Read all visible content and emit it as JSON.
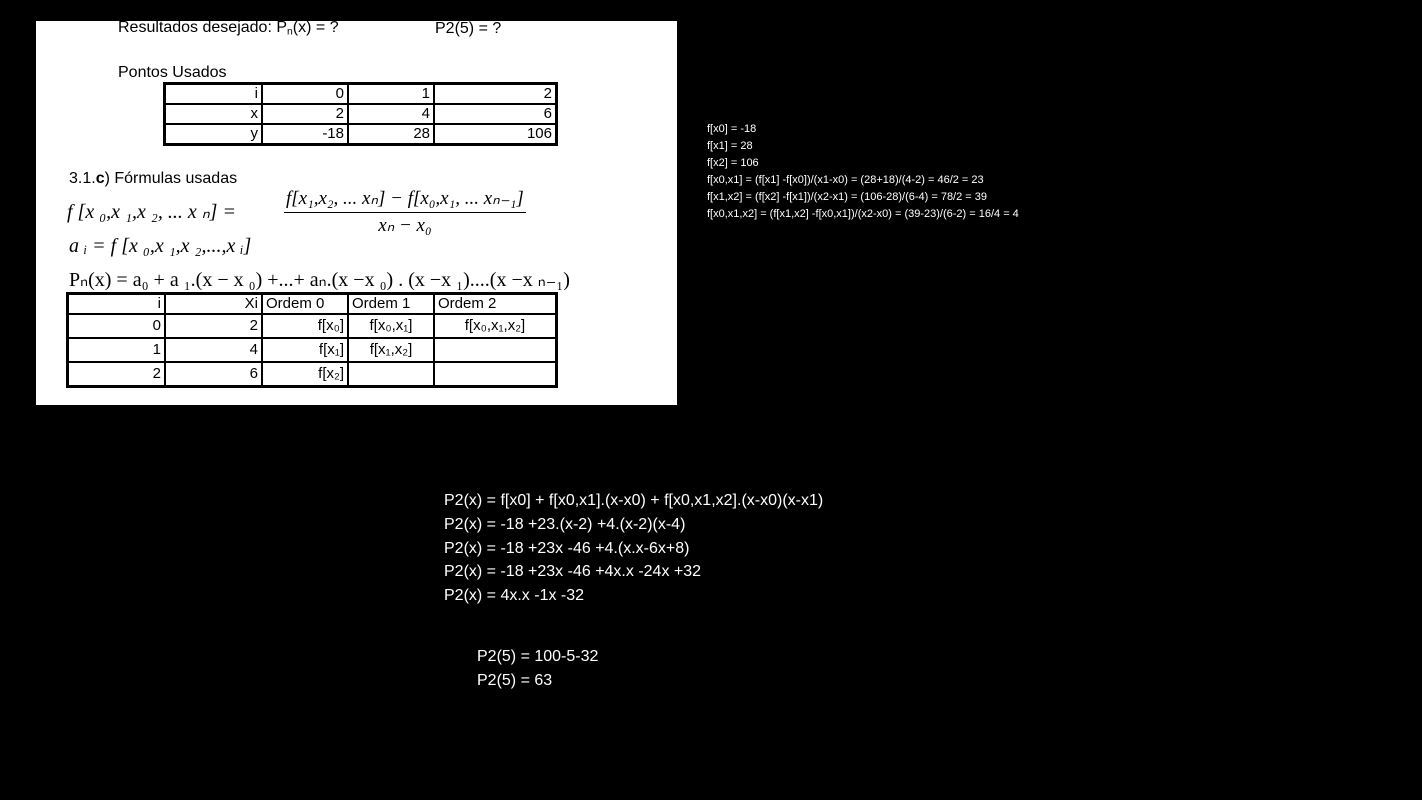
{
  "sheet": {
    "desired_label": "Resultados desejado:",
    "desired_pn": "P",
    "desired_pn_sub": "n",
    "desired_pn_tail": "(x) = ?",
    "desired_p2": "P2(5) = ?",
    "points_title": "Pontos Usados",
    "points_table": {
      "rows": [
        [
          "i",
          "0",
          "1",
          "2"
        ],
        [
          "x",
          "2",
          "4",
          "6"
        ],
        [
          "y",
          "-18",
          "28",
          "106"
        ]
      ]
    },
    "formulas_title_prefix": "3.1.",
    "formulas_title_bold": "c",
    "formulas_title_suffix": ") Fórmulas usadas",
    "formula_f_lhs": "f [x ₀,x ₁,x ₂, ... x ₙ] =",
    "formula_f_num": "f[x₁,x₂, ... xₙ] − f[x₀,x₁, ... xₙ₋₁]",
    "formula_f_den": "xₙ − x₀",
    "formula_a": "a ᵢ = f [x ₀,x ₁,x ₂,...,x ᵢ]",
    "formula_p": "Pₙ(x) = a₀ + a ₁.(x − x ₀) +...+ aₙ.(x −x ₀) . (x −x ₁)....(x −x ₙ₋₁)",
    "dd_table": {
      "headers": [
        "i",
        "Xi",
        "Ordem 0",
        "Ordem 1",
        "Ordem 2"
      ],
      "rows": [
        [
          "0",
          "2",
          "f[x₀]",
          "f[x₀,x₁]",
          "f[x₀,x₁,x₂]"
        ],
        [
          "1",
          "4",
          "f[x₁]",
          "f[x₁,x₂]",
          ""
        ],
        [
          "2",
          "6",
          "f[x₂]",
          "",
          ""
        ]
      ]
    }
  },
  "notes": [
    "f[x0] = -18",
    "f[x1] = 28",
    "f[x2] = 106",
    "f[x0,x1] = (f[x1] -f[x0])/(x1-x0) = (28+18)/(4-2) = 46/2 = 23",
    "f[x1,x2] = (f[x2] -f[x1])/(x2-x1) = (106-28)/(6-4) = 78/2 = 39",
    "f[x0,x1,x2] = (f[x1,x2] -f[x0,x1])/(x2-x0) = (39-23)/(6-2) = 16/4 = 4"
  ],
  "polynomial": [
    "P2(x) = f[x0] + f[x0,x1].(x-x0) + f[x0,x1,x2].(x-x0)(x-x1)",
    "P2(x) = -18 +23.(x-2) +4.(x-2)(x-4)",
    "P2(x) = -18 +23x -46 +4.(x.x-6x+8)",
    "P2(x) = -18 +23x -46 +4x.x -24x +32",
    "P2(x) = 4x.x -1x -32"
  ],
  "result": [
    "P2(5) = 100-5-32",
    "P2(5) = 63"
  ]
}
